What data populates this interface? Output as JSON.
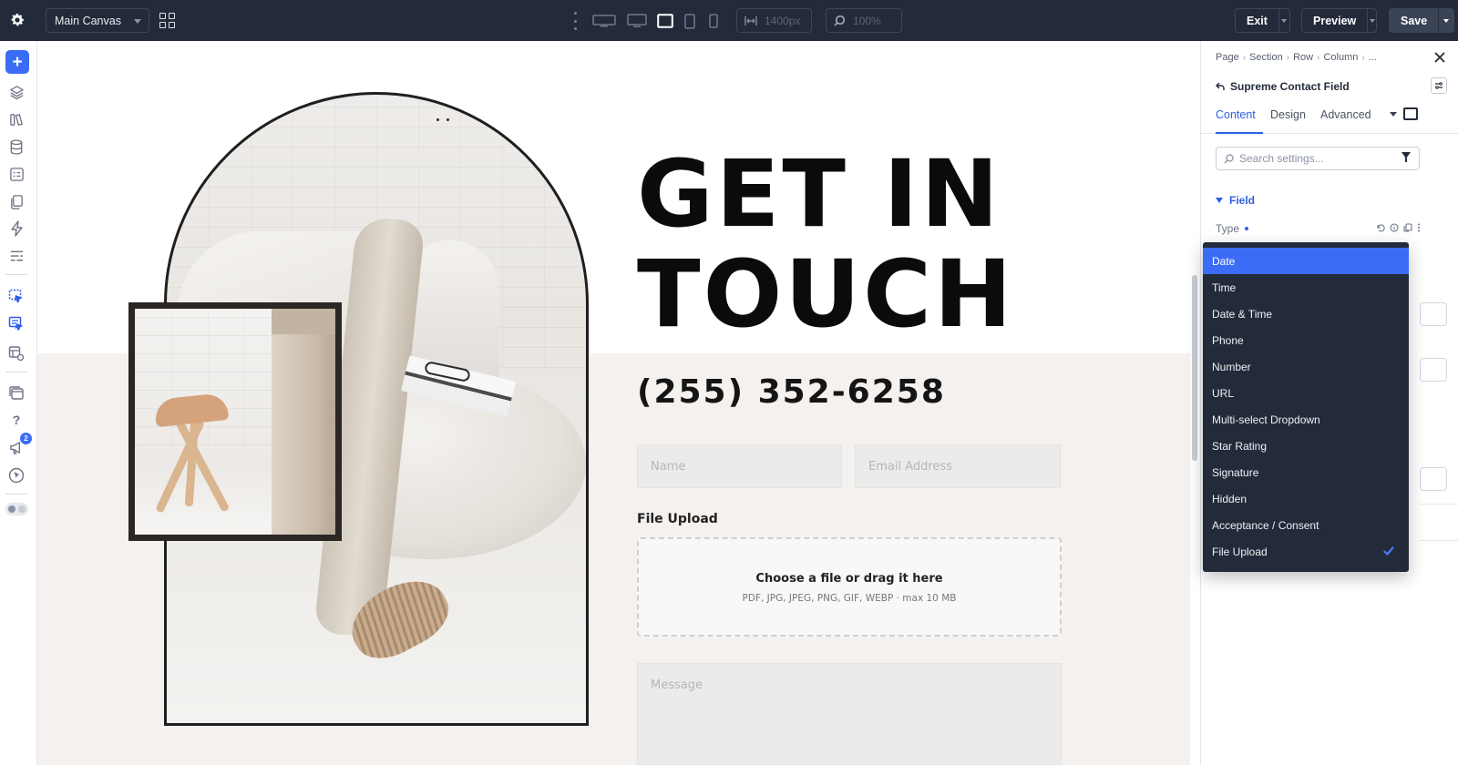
{
  "topbar": {
    "canvas_select": "Main Canvas",
    "width_value": "1400px",
    "zoom_value": "100%",
    "exit_label": "Exit",
    "preview_label": "Preview",
    "save_label": "Save"
  },
  "sidebar": {
    "notification_count": "2",
    "accent": "#3b6cf6"
  },
  "canvas": {
    "title_line1": "GET IN",
    "title_line2": "TOUCH",
    "phone": "(255) 352-6258",
    "name_placeholder": "Name",
    "email_placeholder": "Email Address",
    "file_upload_label": "File Upload",
    "dropzone_main": "Choose a file or drag it here",
    "dropzone_sub": "PDF, JPG, JPEG, PNG, GIF, WEBP · max 10 MB",
    "message_placeholder": "Message"
  },
  "panel": {
    "breadcrumbs": [
      "Page",
      "Section",
      "Row",
      "Column",
      "..."
    ],
    "module_title": "Supreme Contact Field",
    "tabs": [
      "Content",
      "Design",
      "Advanced"
    ],
    "active_tab": "Content",
    "search_placeholder": "Search settings...",
    "group_label": "Field",
    "type_label": "Type",
    "type_options": [
      "Date",
      "Time",
      "Date & Time",
      "Phone",
      "Number",
      "URL",
      "Multi-select Dropdown",
      "Star Rating",
      "Signature",
      "Hidden",
      "Acceptance / Consent",
      "File Upload"
    ],
    "highlighted_option": "Date",
    "checked_option": "File Upload"
  }
}
